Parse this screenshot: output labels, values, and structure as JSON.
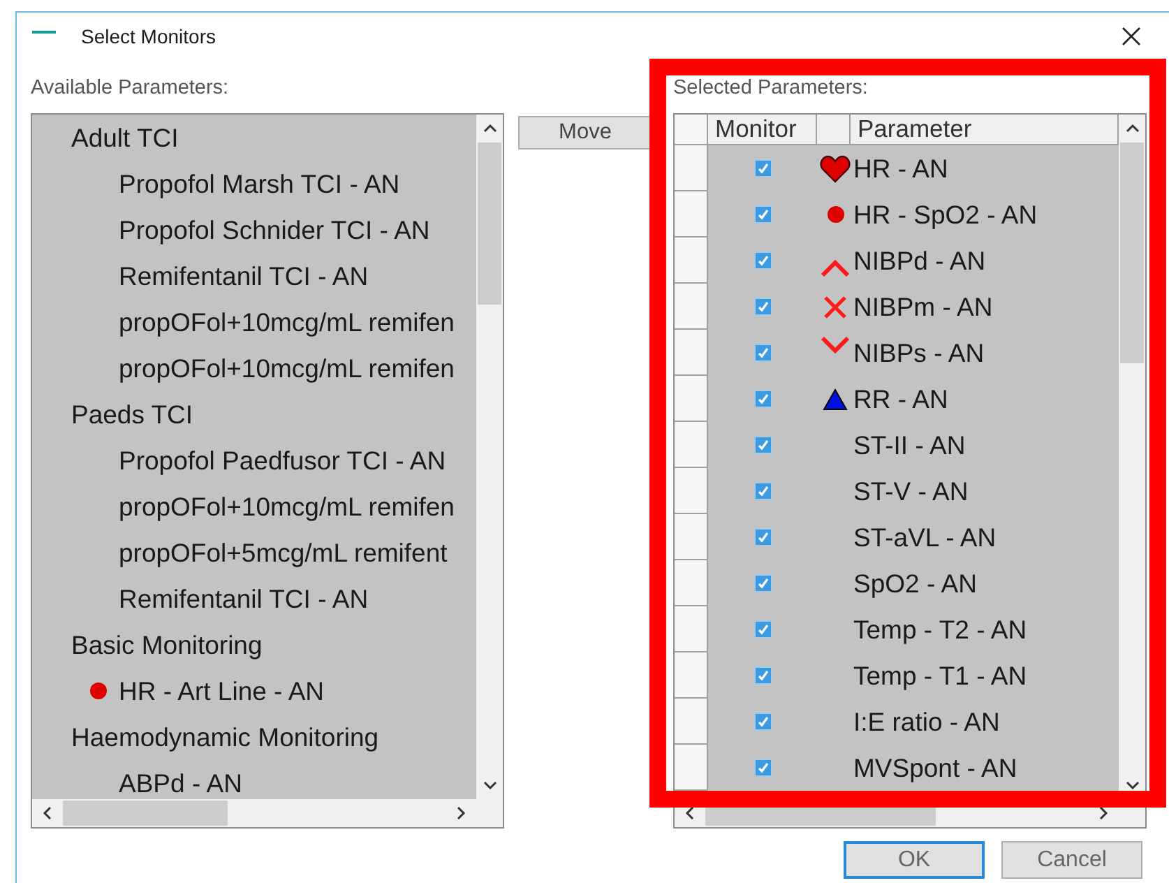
{
  "window": {
    "title": "Select Monitors"
  },
  "available": {
    "label": "Available Parameters:",
    "groups": [
      {
        "label": "Adult TCI",
        "children": [
          {
            "label": "Propofol Marsh TCI - AN"
          },
          {
            "label": "Propofol Schnider TCI - AN"
          },
          {
            "label": "Remifentanil TCI - AN"
          },
          {
            "label": "propOFol+10mcg/mL remifen"
          },
          {
            "label": "propOFol+10mcg/mL remifen"
          }
        ]
      },
      {
        "label": "Paeds TCI",
        "children": [
          {
            "label": "Propofol Paedfusor TCI - AN"
          },
          {
            "label": "propOFol+10mcg/mL remifen"
          },
          {
            "label": "propOFol+5mcg/mL remifent"
          },
          {
            "label": "Remifentanil TCI - AN"
          }
        ]
      },
      {
        "label": "Basic Monitoring",
        "children": [
          {
            "label": "HR - Art Line - AN",
            "kind": "dot"
          }
        ]
      },
      {
        "label": "Haemodynamic Monitoring",
        "children": [
          {
            "label": "ABPd - AN"
          }
        ]
      }
    ]
  },
  "move_button": "Move",
  "selected": {
    "label": "Selected Parameters:",
    "columns": [
      "Monitor",
      "Parameter"
    ],
    "rows": [
      {
        "checked": true,
        "kind": "heart",
        "label": "HR - AN"
      },
      {
        "checked": true,
        "kind": "dot",
        "label": "HR - SpO2 - AN"
      },
      {
        "checked": true,
        "kind": "caret-up",
        "label": "NIBPd - AN"
      },
      {
        "checked": true,
        "kind": "cross",
        "label": "NIBPm - AN"
      },
      {
        "checked": true,
        "kind": "caret-down",
        "label": "NIBPs - AN"
      },
      {
        "checked": true,
        "kind": "triangle",
        "label": "RR - AN"
      },
      {
        "checked": true,
        "label": "ST-II - AN"
      },
      {
        "checked": true,
        "label": "ST-V - AN"
      },
      {
        "checked": true,
        "label": "ST-aVL - AN"
      },
      {
        "checked": true,
        "label": "SpO2 - AN"
      },
      {
        "checked": true,
        "label": "Temp - T2 - AN"
      },
      {
        "checked": true,
        "label": "Temp - T1 - AN"
      },
      {
        "checked": true,
        "label": "I:E ratio - AN"
      },
      {
        "checked": true,
        "label": "MVSpont - AN"
      }
    ]
  },
  "highlight_frame": true,
  "buttons": [
    {
      "label": "OK",
      "default": true
    },
    {
      "label": "Cancel",
      "default": false
    }
  ]
}
